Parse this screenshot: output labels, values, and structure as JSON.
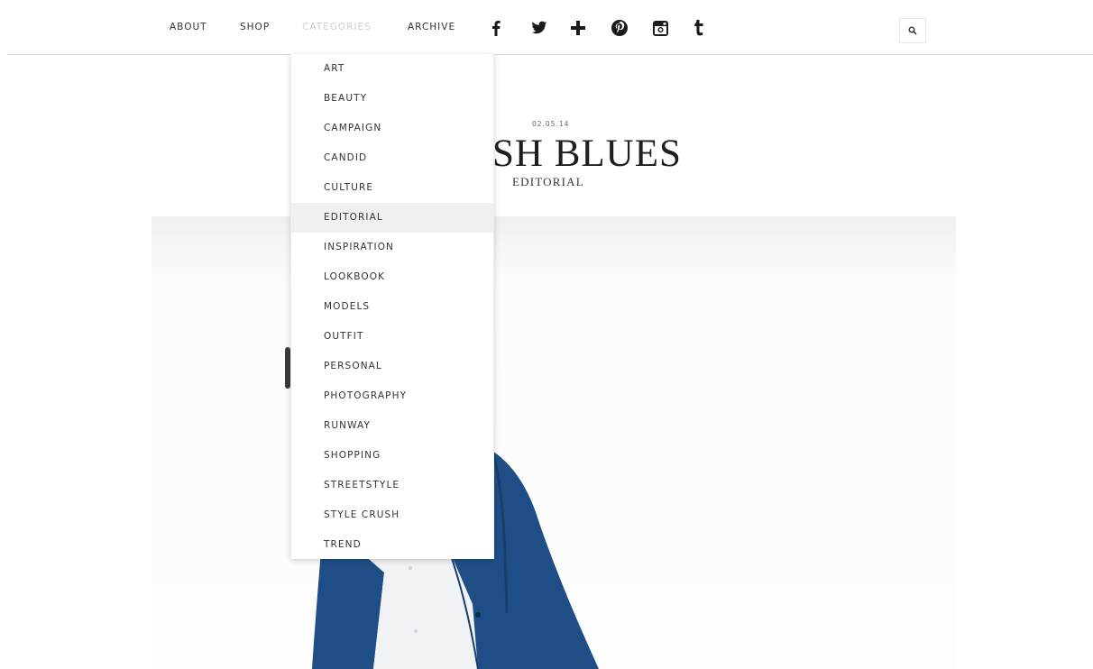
{
  "nav": {
    "links": [
      "ABOUT",
      "SHOP",
      "CATEGORIES",
      "ARCHIVE"
    ],
    "active": "CATEGORIES"
  },
  "social": {
    "icons": [
      "facebook-icon",
      "twitter-icon",
      "google-plus-icon",
      "pinterest-icon",
      "instagram-icon",
      "tumblr-icon"
    ],
    "facebook": "f",
    "tumblr": "t",
    "plus": "+"
  },
  "search": {
    "icon": "search-icon"
  },
  "categories": {
    "items": [
      "ART",
      "BEAUTY",
      "CAMPAIGN",
      "CANDID",
      "CULTURE",
      "EDITORIAL",
      "INSPIRATION",
      "LOOKBOOK",
      "MODELS",
      "OUTFIT",
      "PERSONAL",
      "PHOTOGRAPHY",
      "RUNWAY",
      "SHOPPING",
      "STREETSTYLE",
      "STYLE CRUSH",
      "TREND"
    ],
    "highlighted": "EDITORIAL"
  },
  "post": {
    "date": "02.05.14",
    "title_visible": "SH BLUES",
    "category": "EDITORIAL"
  },
  "colors": {
    "jacket": "#1f4e86",
    "shirt": "#f2f3f6",
    "nav_active": "#cfcfcf"
  }
}
